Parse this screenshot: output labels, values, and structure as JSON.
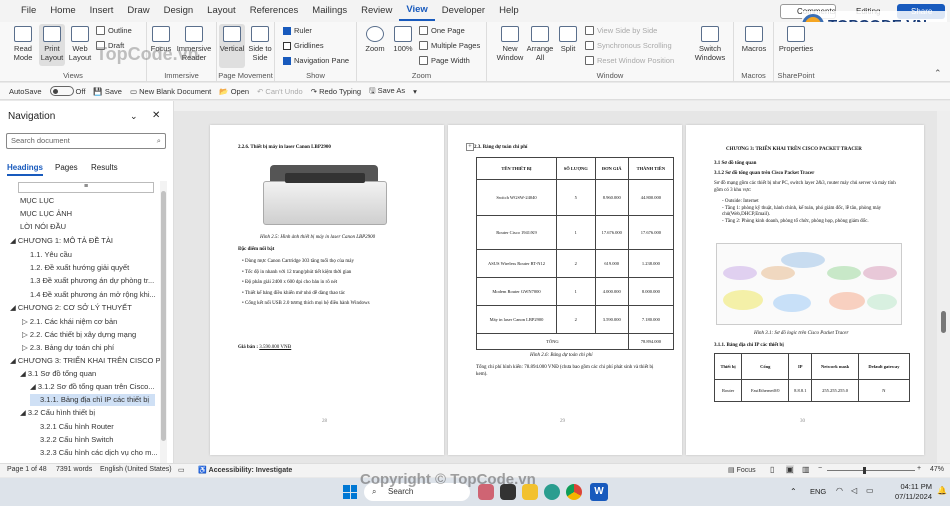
{
  "menu": {
    "tabs": [
      "File",
      "Home",
      "Insert",
      "Draw",
      "Design",
      "Layout",
      "References",
      "Mailings",
      "Review",
      "View",
      "Developer",
      "Help"
    ],
    "active": "View",
    "comments": "Comments",
    "editing": "Editing",
    "share": "Share"
  },
  "watermark": {
    "top": "TOPCODE.VN",
    "center": "TopCode.vn",
    "bottom": "Copyright © TopCode.vn"
  },
  "ribbon": {
    "views": {
      "read": "Read Mode",
      "print": "Print Layout",
      "web": "Web Layout",
      "outline": "Outline",
      "draft": "Draft",
      "label": "Views"
    },
    "immersive": {
      "focus": "Focus",
      "reader": "Immersive Reader",
      "label": "Immersive"
    },
    "pagemove": {
      "vertical": "Vertical",
      "side": "Side to Side",
      "label": "Page Movement"
    },
    "show": {
      "ruler": "Ruler",
      "gridlines": "Gridlines",
      "navpane": "Navigation Pane",
      "label": "Show"
    },
    "zoom": {
      "zoom": "Zoom",
      "pct": "100%",
      "one": "One Page",
      "multi": "Multiple Pages",
      "width": "Page Width",
      "label": "Zoom"
    },
    "window": {
      "new": "New Window",
      "arrange": "Arrange All",
      "split": "Split",
      "side": "View Side by Side",
      "sync": "Synchronous Scrolling",
      "reset": "Reset Window Position",
      "switch": "Switch Windows",
      "label": "Window"
    },
    "macros": {
      "btn": "Macros",
      "label": "Macros"
    },
    "sp": {
      "btn": "Properties",
      "label": "SharePoint"
    }
  },
  "qat": {
    "autosave": "AutoSave",
    "off": "Off",
    "save": "Save",
    "newdoc": "New Blank Document",
    "open": "Open",
    "undo": "Can't Undo",
    "redo": "Redo Typing",
    "saveas": "Save As"
  },
  "nav": {
    "title": "Navigation",
    "search": "Search document",
    "tabs": [
      "Headings",
      "Pages",
      "Results"
    ],
    "items": [
      "MỤC LỤC",
      "MỤC LỤC ẢNH",
      "LỜI NÓI ĐẦU",
      "CHƯƠNG 1: MÔ TẢ ĐỀ TÀI",
      "1.1. Yêu cầu",
      "1.2. Đề xuất hướng giải quyết",
      "1.3 Đề xuất phương án dự phòng tr...",
      "1.4 Đề xuất phương án mở rộng khi...",
      "CHƯƠNG 2: CƠ SỞ LÝ THUYẾT",
      "2.1. Các khái niệm cơ bản",
      "2.2. Các thiết bị xây dựng mạng",
      "2.3. Bảng dự toán chi phí",
      "CHƯƠNG 3: TRIỂN KHAI TRÊN CISCO P...",
      "3.1 Sơ đồ tổng quan",
      "3.1.2 Sơ đồ tổng quan trên Cisco...",
      "3.1.1. Bảng địa chỉ IP các thiết bị",
      "3.2 Cấu hình thiết bị",
      "3.2.1 Cấu hình Router",
      "3.2.2 Cấu hình Switch",
      "3.2.3 Cấu hình các dịch vụ cho m..."
    ]
  },
  "page28": {
    "heading": "2.2.6. Thiết bị máy in laser Canon LBP2900",
    "caption": "Hình 2.5: Hình ảnh thiết bị máy in laser Canon LBP2900",
    "feat": "Đặc điểm nổi bật",
    "bullets": [
      "Dùng mực Canon Cartridge 303 tăng tuổi thọ của máy",
      "Tốc độ in nhanh với 12 trang/phút tiết kiệm thời gian",
      "Độ phân giải 2400 x 600 dpi cho bản in rõ nét",
      "Thiết kế bảng điều khiển mở nhỏ dễ dàng thao tác",
      "Cổng kết nối USB 2.0 tương thích mọi hệ điều hành Windows"
    ],
    "price_label": "Giá bán :",
    "price": "3.590.000 VNĐ",
    "num": "28"
  },
  "page29": {
    "heading": "2.3. Bảng dự toán chi phí",
    "headers": [
      "TÊN THIẾT BỊ",
      "SỐ LƯỢNG",
      "ĐƠN GIÁ",
      "THÀNH TIỀN"
    ],
    "rows": [
      [
        "Switch WGSW-24040",
        "5",
        "8.960.000",
        "44.800.000"
      ],
      [
        "Router Cisco 1941/K9",
        "1",
        "17.676.000",
        "17.676.000"
      ],
      [
        "ASUS Wireless Router RT-N12",
        "2",
        "619.000",
        "1.238.000"
      ],
      [
        "Modem Router GWN7000",
        "1",
        "4.000.000",
        "8.000.000"
      ],
      [
        "Máy in laser Canon LBP2900",
        "2",
        "3.590.000",
        "7.180.000"
      ]
    ],
    "total_label": "TỔNG",
    "total": "78.894.000",
    "caption": "Hình 2.6: Bảng dự toán chi phí",
    "note": "Tổng chi phí hình kiến: 78.894.000 VNĐ (chưa bao gồm các chi phí phát sinh và thiết bị kem).",
    "num": "29"
  },
  "page30": {
    "title": "CHƯƠNG 3: TRIỂN KHAI TRÊN CISCO PACKET TRACER",
    "h1": "3.1 Sơ đồ tổng quan",
    "h2": "3.1.2 Sơ đồ tổng quan trên Cisco Packet Tracer",
    "p1": "Sơ đồ mạng gồm các thiết bị như PC, switch layer 2&3, router máy chủ server và máy tính gồm có 3 khu vực:",
    "b": [
      "Outside: Internet",
      "Tầng 1: phòng kỹ thuật, hành chính, kế toán, phó giám đốc, lễ tân, phòng máy chủ(Web,DHCP,Email).",
      "Tầng 2: Phòng kinh doanh, phòng tổ chức, phòng họp, phòng giám đốc."
    ],
    "caption": "Hình 3.1: Sơ đồ logic trên Cisco Packet Tracer",
    "h3": "3.1.1. Bảng địa chỉ IP các thiết bị",
    "th": [
      "Thiết bị",
      "Cổng",
      "IP",
      "Network mask",
      "Default gateway"
    ],
    "tr": [
      "Router",
      "FastEthernet0/0",
      "8.8.8.1",
      "255.255.255.0",
      "N"
    ],
    "num": "30"
  },
  "status": {
    "page": "Page 1 of 48",
    "words": "7391 words",
    "lang": "English (United States)",
    "access": "Accessibility: Investigate",
    "focus": "Focus",
    "zoom": "47%"
  },
  "taskbar": {
    "search": "Search",
    "lang": "ENG",
    "time": "04:11 PM",
    "date": "07/11/2024"
  }
}
